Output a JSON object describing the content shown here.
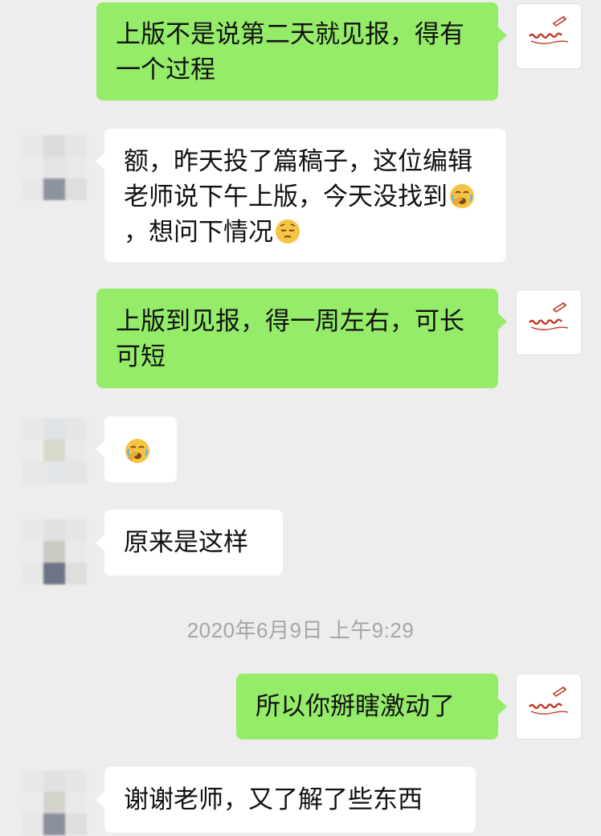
{
  "chat": {
    "messages": [
      {
        "side": "out",
        "text": "上版不是说第二天就见报，得有一个过程"
      },
      {
        "side": "in",
        "parts": [
          "额，昨天投了篇稿子，这位编辑老师说下午上版，今天没找到",
          "，想问下情况"
        ],
        "emojis": [
          "facepalm-emoji",
          "pensive-emoji"
        ]
      },
      {
        "side": "out",
        "text": "上版到见报，得一周左右，可长可短"
      },
      {
        "side": "in",
        "emojis": [
          "facepalm-emoji"
        ]
      },
      {
        "side": "in",
        "text": "原来是这样"
      },
      {
        "side": "out",
        "text": "所以你掰瞎激动了"
      },
      {
        "side": "in",
        "text": "谢谢老师，又了解了些东西"
      }
    ],
    "timestamp": "2020年6月9日 上午9:29"
  },
  "avatar": {
    "self_icon": "calligraphy-logo-icon",
    "other_icon": "pixelated-avatar-icon"
  },
  "colors": {
    "background": "#ededed",
    "outgoing_bubble": "#95ec69",
    "incoming_bubble": "#ffffff",
    "timestamp_text": "#a6a6a6",
    "logo_red": "#c0392b"
  }
}
